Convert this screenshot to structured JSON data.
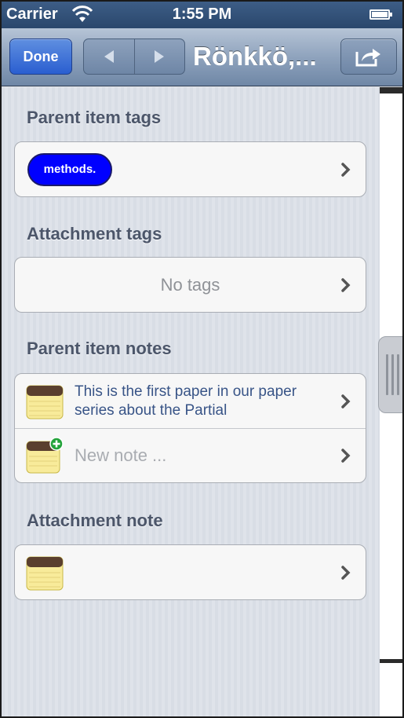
{
  "status_bar": {
    "carrier": "Carrier",
    "time": "1:55 PM"
  },
  "nav_bar": {
    "done_label": "Done",
    "title": "Rönkkö,...",
    "prev_icon": "triangle-left-icon",
    "next_icon": "triangle-right-icon",
    "share_icon": "share-icon"
  },
  "sections": {
    "parent_item_tags": {
      "title": "Parent item tags",
      "tag_label": "methods.",
      "tag_color": "#0000ff"
    },
    "attachment_tags": {
      "title": "Attachment tags",
      "empty_label": "No tags"
    },
    "parent_item_notes": {
      "title": "Parent item notes",
      "note_text": "This is the first paper in our paper series about the Partial",
      "new_note_placeholder": "New note ..."
    },
    "attachment_note": {
      "title": "Attachment note"
    }
  },
  "colors": {
    "nav_accent": "#2a5ed0",
    "note_text": "#385487"
  }
}
